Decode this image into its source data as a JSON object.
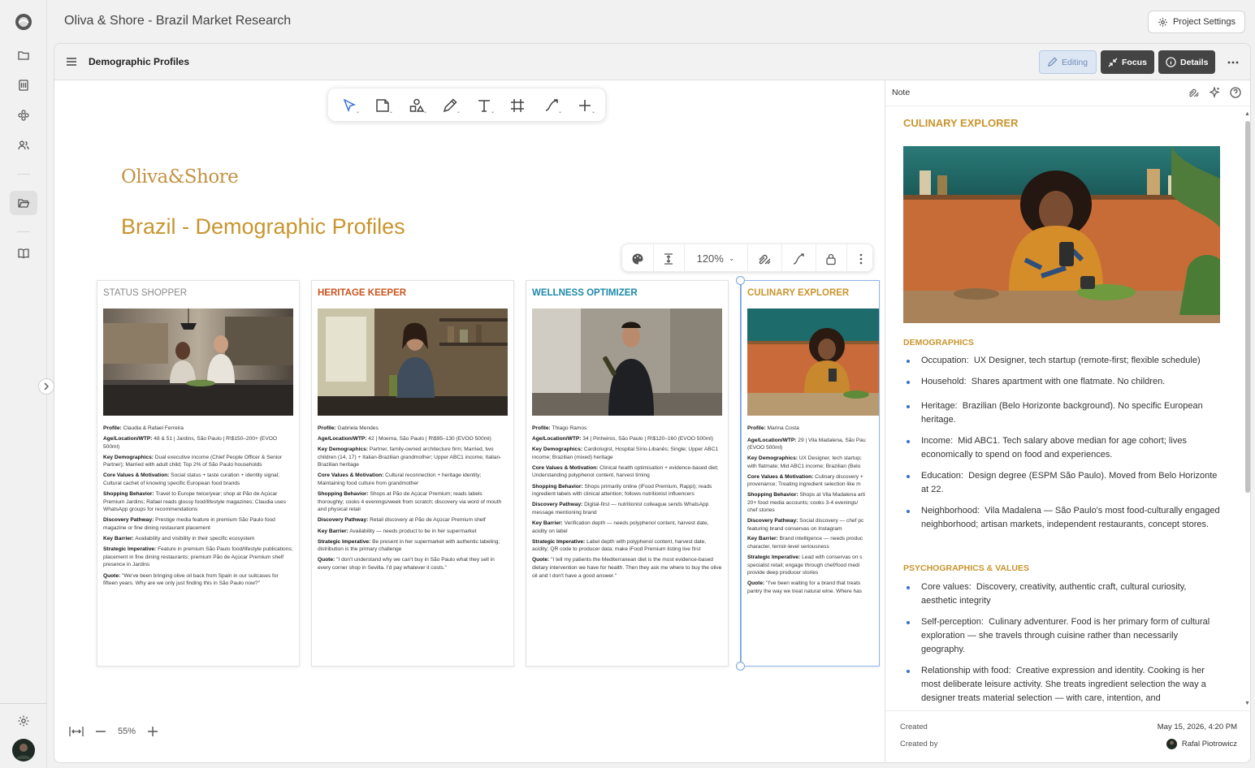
{
  "app": {
    "title": "Oliva & Shore - Brazil Market Research",
    "project_settings_label": "Project Settings"
  },
  "doc": {
    "title": "Demographic Profiles",
    "editing_label": "Editing",
    "focus_label": "Focus",
    "details_label": "Details"
  },
  "canvas": {
    "logo_text": "Oliva&Shore",
    "page_title": "Brazil - Demographic Profiles",
    "zoom_level": "120%",
    "canvas_zoom": "55%"
  },
  "colors": {
    "accent_gold": "#c8952e",
    "heritage_red": "#c9551f",
    "wellness_teal": "#1e8aa8",
    "selection_blue": "#7aa5dd"
  },
  "cards": [
    {
      "title": "STATUS SHOPPER",
      "fields": [
        {
          "k": "Profile:",
          "v": " Claudia & Rafael Ferreira"
        },
        {
          "k": "Age/Location/WTP:",
          "v": " 48 & 51 | Jardins, São Paulo | R\\$150–200+ (EVOO 500ml)"
        },
        {
          "k": "Key Demographics:",
          "v": " Dual executive income (Chief People Officer & Senior Partner); Married with adult child; Top 2% of São Paulo households"
        },
        {
          "k": "Core Values & Motivation:",
          "v": " Social status + taste curation + identity signal; Cultural cachet of knowing specific European food brands"
        },
        {
          "k": "Shopping Behavior:",
          "v": " Travel to Europe twice/year; shop at Pão de Açúcar Premium Jardins; Rafael reads glossy food/lifestyle magazines; Claudia uses WhatsApp groups for recommendations"
        },
        {
          "k": "Discovery Pathway:",
          "v": " Prestige media feature in premium São Paulo food magazine or fine dining restaurant placement"
        },
        {
          "k": "Key Barrier:",
          "v": " Availability and visibility in their specific ecosystem"
        },
        {
          "k": "Strategic Imperative:",
          "v": " Feature in premium São Paulo food/lifestyle publications; placement in fine dining restaurants; premium Pão de Açúcar Premium shelf presence in Jardins"
        },
        {
          "k": "Quote:",
          "v": " \"We've been bringing olive oil back from Spain in our suitcases for fifteen years. Why are we only just finding this in São Paulo now?\""
        }
      ]
    },
    {
      "title": "HERITAGE KEEPER",
      "fields": [
        {
          "k": "Profile:",
          "v": " Gabriela Mendes"
        },
        {
          "k": "Age/Location/WTP:",
          "v": " 42 | Moema, São Paulo | R\\$95–130 (EVOO 500ml)"
        },
        {
          "k": "Key Demographics:",
          "v": " Partner, family-owned architecture firm; Married, two children (14, 17) + Italian-Brazilian grandmother; Upper ABC1 income; Italian-Brazilian heritage"
        },
        {
          "k": "Core Values & Motivation:",
          "v": " Cultural reconnection + heritage identity; Maintaining food culture from grandmother"
        },
        {
          "k": "Shopping Behavior:",
          "v": " Shops at Pão de Açúcar Premium; reads labels thoroughly; cooks 4 evenings/week from scratch; discovery via word of mouth and physical retail"
        },
        {
          "k": "Discovery Pathway:",
          "v": " Retail discovery at Pão de Açúcar Premium shelf"
        },
        {
          "k": "Key Barrier:",
          "v": " Availability — needs product to be in her supermarket"
        },
        {
          "k": "Strategic Imperative:",
          "v": " Be present in her supermarket with authentic labeling; distribution is the primary challenge"
        },
        {
          "k": "Quote:",
          "v": " \"I don't understand why we can't buy in São Paulo what they sell in every corner shop in Sevilla. I'd pay whatever it costs.\""
        }
      ]
    },
    {
      "title": "WELLNESS OPTIMIZER",
      "fields": [
        {
          "k": "Profile:",
          "v": " Thiago Ramos"
        },
        {
          "k": "Age/Location/WTP:",
          "v": " 34 | Pinheiros, São Paulo | R\\$120–160 (EVOO 500ml)"
        },
        {
          "k": "Key Demographics:",
          "v": " Cardiologist, Hospital Sírio-Libanês; Single; Upper ABC1 income; Brazilian (mixed) heritage"
        },
        {
          "k": "Core Values & Motivation:",
          "v": " Clinical health optimisation + evidence-based diet; Understanding polyphenol content, harvest timing"
        },
        {
          "k": "Shopping Behavior:",
          "v": " Shops primarily online (iFood Premium, Rappi); reads ingredient labels with clinical attention; follows nutritionist influencers"
        },
        {
          "k": "Discovery Pathway:",
          "v": " Digital-first — nutritionist colleague sends WhatsApp message mentioning brand"
        },
        {
          "k": "Key Barrier:",
          "v": " Verification depth — needs polyphenol content, harvest date, acidity on label"
        },
        {
          "k": "Strategic Imperative:",
          "v": " Label depth with polyphenol content, harvest date, acidity; QR code to producer data; make iFood Premium listing live first"
        },
        {
          "k": "Quote:",
          "v": " \"I tell my patients the Mediterranean diet is the most evidence-based dietary intervention we have for health. Then they ask me where to buy the olive oil and I don't have a good answer.\""
        }
      ]
    },
    {
      "title": "CULINARY EXPLORER",
      "fields": [
        {
          "k": "Profile:",
          "v": " Marina Costa"
        },
        {
          "k": "Age/Location/WTP:",
          "v": " 29 | Vila Madalena, São Pau"
        },
        {
          "k": "",
          "v": "(EVOO 500ml)"
        },
        {
          "k": "Key Demographics:",
          "v": " UX Designer, tech startup;"
        },
        {
          "k": "",
          "v": "with flatmate; Mid ABC1 income; Brazilian (Belo"
        },
        {
          "k": "Core Values & Motivation:",
          "v": " Culinary discovery +"
        },
        {
          "k": "",
          "v": "provenance; Treating ingredient selection like m"
        },
        {
          "k": "Shopping Behavior:",
          "v": " Shops at Vila Madalena arti"
        },
        {
          "k": "",
          "v": "20+ food media accounts; cooks 3-4 evenings/"
        },
        {
          "k": "",
          "v": "chef stories"
        },
        {
          "k": "Discovery Pathway:",
          "v": " Social discovery — chef pc"
        },
        {
          "k": "",
          "v": "featuring brand conservas on Instagram"
        },
        {
          "k": "Key Barrier:",
          "v": " Brand intelligence — needs produc"
        },
        {
          "k": "",
          "v": "character, terroir-level seriousness"
        },
        {
          "k": "Strategic Imperative:",
          "v": " Lead with conservas on s"
        },
        {
          "k": "",
          "v": "specialist retail; engage through chef/food medi"
        },
        {
          "k": "",
          "v": "provide deep producer stories"
        },
        {
          "k": "Quote:",
          "v": " \"I've been waiting for a brand that treats"
        },
        {
          "k": "",
          "v": "pantry the way we treat natural wine. Where has"
        }
      ]
    }
  ],
  "panel": {
    "label": "Note",
    "title": "CULINARY EXPLORER",
    "demographics_heading": "DEMOGRAPHICS",
    "demographics": [
      {
        "k": "Occupation:",
        "v": "UX Designer, tech startup (remote-first; flexible schedule)"
      },
      {
        "k": "Household:",
        "v": "Shares apartment with one flatmate. No children."
      },
      {
        "k": "Heritage:",
        "v": "Brazilian (Belo Horizonte background). No specific European heritage."
      },
      {
        "k": "Income:",
        "v": "Mid ABC1. Tech salary above median for age cohort; lives economically to spend on food and experiences."
      },
      {
        "k": "Education:",
        "v": "Design degree (ESPM São Paulo). Moved from Belo Horizonte at 22."
      },
      {
        "k": "Neighborhood:",
        "v": "Vila Madalena — São Paulo's most food-culturally engaged neighborhood; artisan markets, independent restaurants, concept stores."
      }
    ],
    "psychographics_heading": "PSYCHOGRAPHICS & VALUES",
    "psychographics": [
      {
        "k": "Core values:",
        "v": "Discovery, creativity, authentic craft, cultural curiosity, aesthetic integrity"
      },
      {
        "k": "Self-perception:",
        "v": "Culinary adventurer. Food is her primary form of cultural exploration — she travels through cuisine rather than necessarily geography."
      },
      {
        "k": "Relationship with food:",
        "v": "Creative expression and identity. Cooking is her most deliberate leisure activity. She treats ingredient selection the way a designer treats material selection — with care, intention, and"
      }
    ],
    "created_label": "Created",
    "created_value": "May 15, 2026, 4:20 PM",
    "created_by_label": "Created by",
    "created_by_value": "Rafal Piotrowicz"
  }
}
